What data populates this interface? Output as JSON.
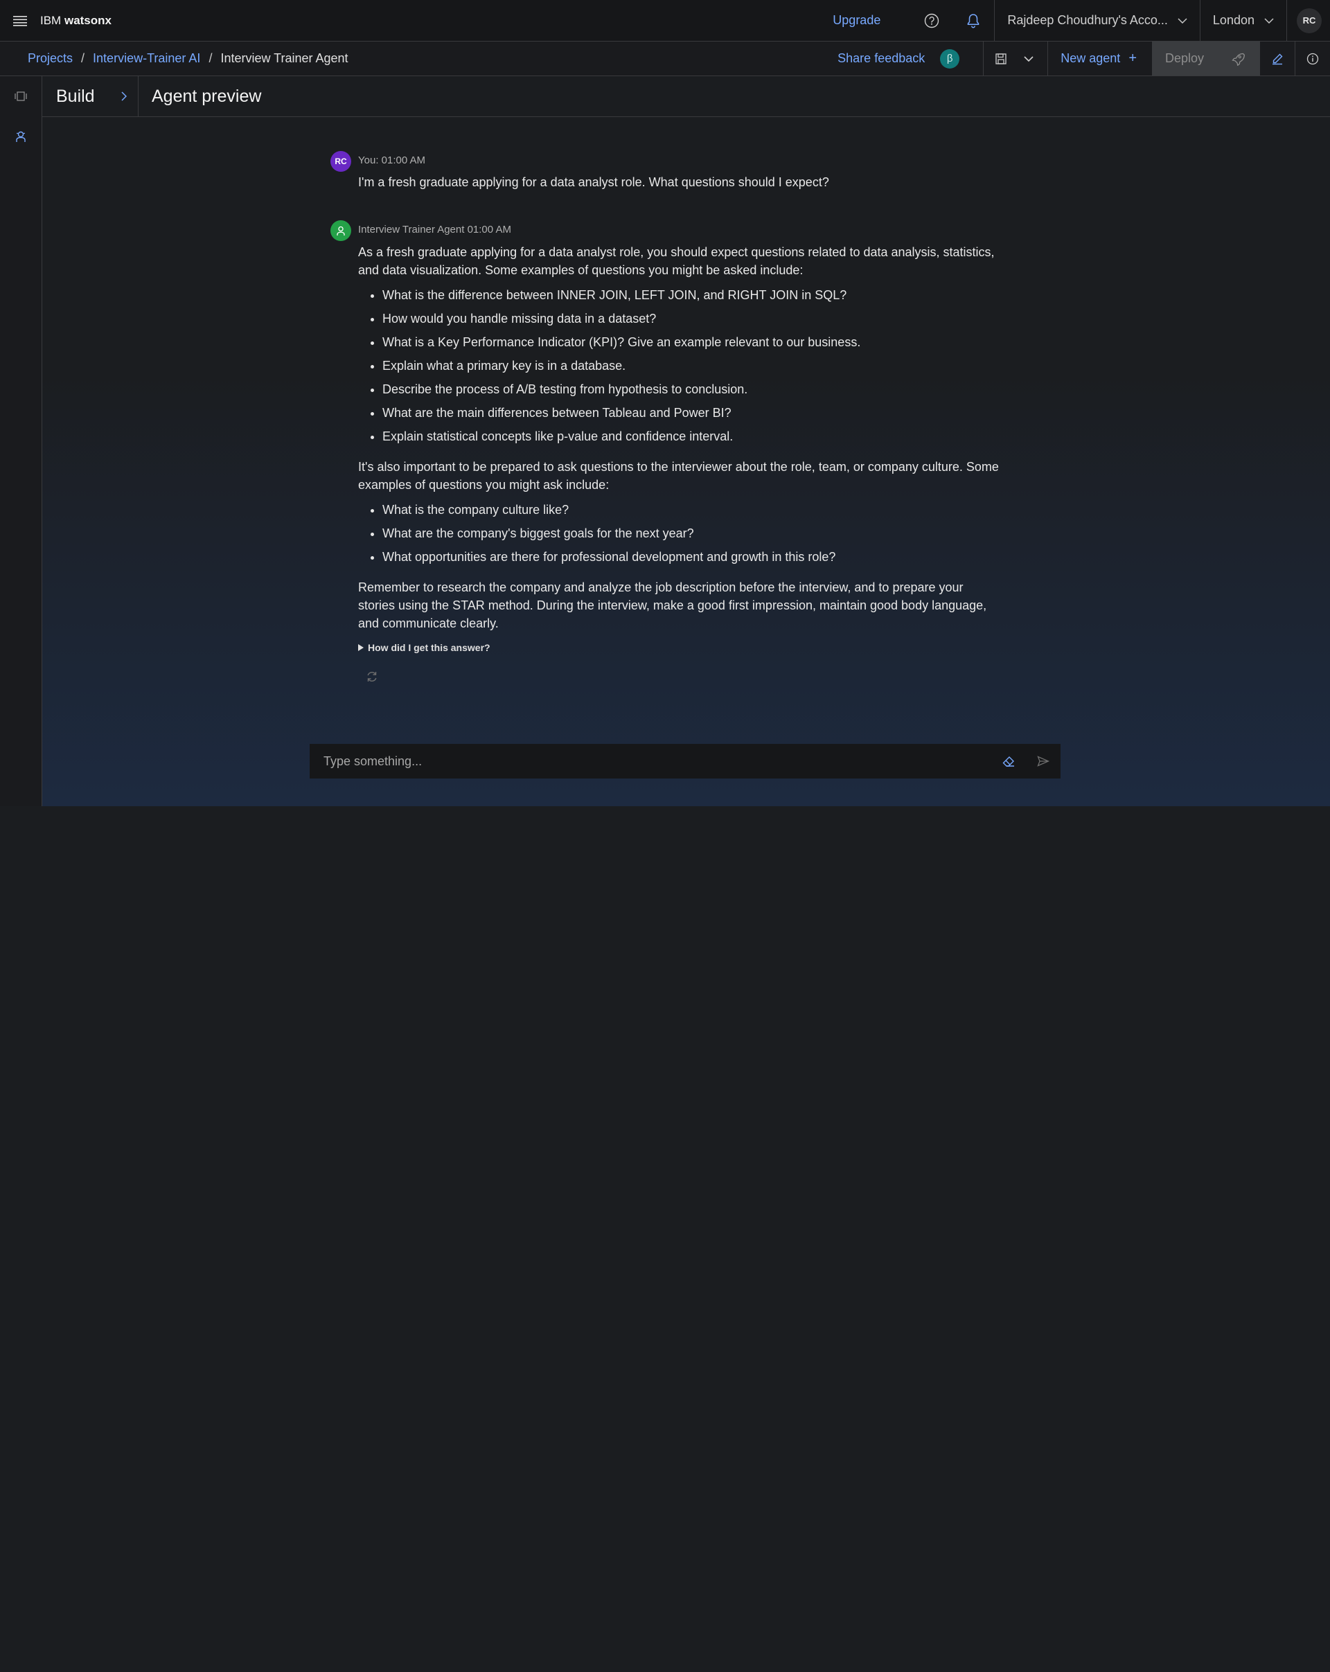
{
  "header": {
    "brand_prefix": "IBM",
    "brand_name": "watsonx",
    "upgrade_label": "Upgrade",
    "account_label": "Rajdeep Choudhury's Acco...",
    "region_label": "London",
    "user_initials": "RC",
    "icons": [
      "menu-icon",
      "help-icon",
      "notification-icon",
      "chevron-down-icon"
    ]
  },
  "breadcrumb": {
    "items": [
      "Projects",
      "Interview-Trainer AI"
    ],
    "current": "Interview Trainer Agent",
    "separator": "/"
  },
  "toolbar": {
    "share_feedback": "Share feedback",
    "beta_badge": "β",
    "new_agent_label": "New agent",
    "new_agent_plus": "+",
    "deploy_label": "Deploy",
    "icons": [
      "save-icon",
      "chevron-down-icon",
      "plus-icon",
      "rocket-icon",
      "edit-icon",
      "info-icon"
    ]
  },
  "sidebar": {
    "icons": [
      "agent-tools-icon",
      "agent-icon"
    ]
  },
  "panel": {
    "build_label": "Build",
    "preview_title": "Agent preview"
  },
  "chat": {
    "user_message": {
      "initials": "RC",
      "meta": "You: 01:00 AM",
      "text": "I'm a fresh graduate applying for a data analyst role. What questions should I expect?"
    },
    "agent_message": {
      "meta": "Interview Trainer Agent 01:00 AM",
      "intro": "As a fresh graduate applying for a data analyst role, you should expect questions related to data analysis, statistics, and data visualization. Some examples of questions you might be asked include:",
      "questions_expected": [
        "What is the difference between INNER JOIN, LEFT JOIN, and RIGHT JOIN in SQL?",
        "How would you handle missing data in a dataset?",
        "What is a Key Performance Indicator (KPI)? Give an example relevant to our business.",
        "Explain what a primary key is in a database.",
        "Describe the process of A/B testing from hypothesis to conclusion.",
        "What are the main differences between Tableau and Power BI?",
        "Explain statistical concepts like p-value and confidence interval."
      ],
      "middle": "It's also important to be prepared to ask questions to the interviewer about the role, team, or company culture. Some examples of questions you might ask include:",
      "questions_to_ask": [
        "What is the company culture like?",
        "What are the company's biggest goals for the next year?",
        "What opportunities are there for professional development and growth in this role?"
      ],
      "closing": "Remember to research the company and analyze the job description before the interview, and to prepare your stories using the STAR method. During the interview, make a good first impression, maintain good body language, and communicate clearly.",
      "how_label": "How did I get this answer?"
    }
  },
  "composer": {
    "placeholder": "Type something...",
    "icons": [
      "eraser-icon",
      "send-icon"
    ]
  },
  "colors": {
    "accent": "#78a9ff",
    "user_avatar": "#6929c4",
    "agent_avatar": "#24a148",
    "beta_badge": "#117a7a",
    "background": "#1b1d20"
  }
}
